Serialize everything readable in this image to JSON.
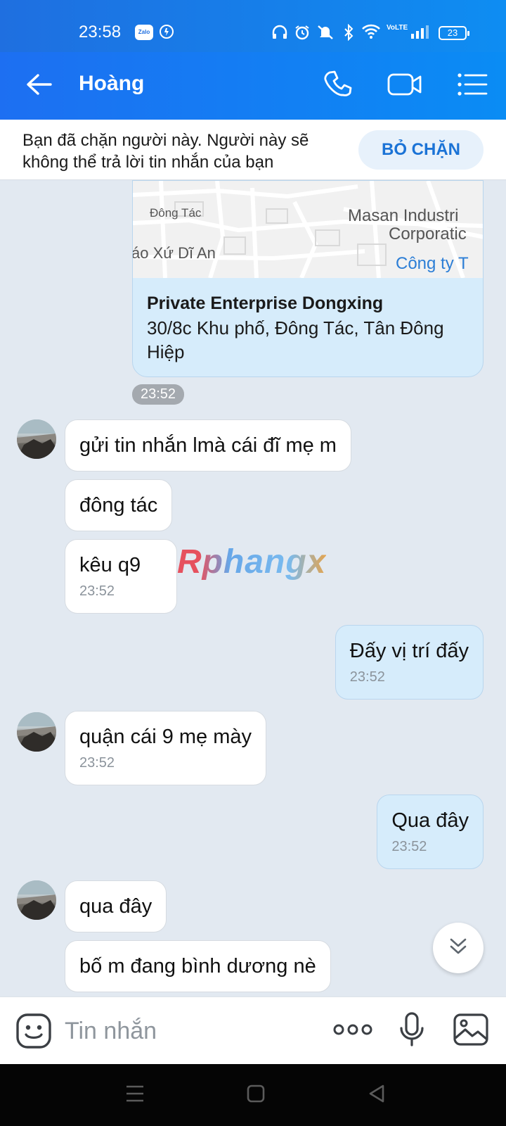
{
  "status_bar": {
    "time": "23:58",
    "app_badge": "Zalo",
    "network": "VoLTE",
    "battery": "23"
  },
  "header": {
    "title": "Hoàng",
    "icons": [
      "back-arrow-icon",
      "phone-icon",
      "video-call-icon",
      "menu-list-icon"
    ]
  },
  "blocked_banner": {
    "text": "Bạn đã chặn người này. Người này sẽ không thể trả lời tin nhắn của bạn",
    "button": "BỎ CHẶN"
  },
  "map_card": {
    "labels": [
      "Đông Tác",
      "Masan Industri",
      "Corporatic",
      "áo Xứ Dĩ An",
      "Công ty T"
    ],
    "place_name": "Private Enterprise Dongxing",
    "address": "30/8c Khu phố, Đông Tác, Tân Đông Hiệp",
    "time": "23:52"
  },
  "messages": [
    {
      "dir": "in",
      "text": "gửi tin nhắn lmà cái đĩ mẹ m",
      "time": ""
    },
    {
      "dir": "in",
      "text": "đông tác",
      "time": ""
    },
    {
      "dir": "in",
      "text": "kêu q9",
      "time": "23:52"
    },
    {
      "dir": "out",
      "text": "Đấy vị trí đấy",
      "time": "23:52"
    },
    {
      "dir": "in",
      "text": "quận cái 9 mẹ mày",
      "time": "23:52"
    },
    {
      "dir": "out",
      "text": "Qua đây",
      "time": "23:52"
    },
    {
      "dir": "in",
      "text": "qua đây",
      "time": ""
    },
    {
      "dir": "in",
      "text": "bố m đang bình dương nè",
      "time": ""
    }
  ],
  "watermark": "Rphangx",
  "input": {
    "placeholder": "Tin nhắn"
  },
  "colors": {
    "header_blue": "#1d6ff2",
    "outgoing_bubble": "#d6ecfb",
    "incoming_bubble": "#ffffff",
    "chat_background": "#e2e9f1",
    "accent": "#1b73d6"
  }
}
